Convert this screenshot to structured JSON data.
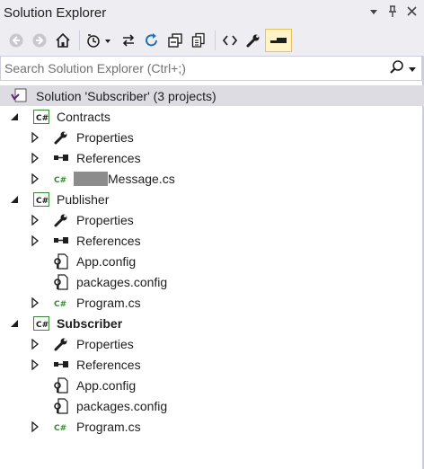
{
  "window": {
    "title": "Solution Explorer"
  },
  "search": {
    "placeholder": "Search Solution Explorer (Ctrl+;)"
  },
  "tree": {
    "solution": {
      "label": "Solution 'Subscriber' (3 projects)"
    },
    "projects": [
      {
        "name": "Contracts",
        "children": [
          {
            "label": "Properties",
            "icon": "wrench-icon"
          },
          {
            "label": "References",
            "icon": "references-icon"
          },
          {
            "label": "Message.cs",
            "icon": "csharp-file-icon",
            "redacted_prefix": true
          }
        ]
      },
      {
        "name": "Publisher",
        "children": [
          {
            "label": "Properties",
            "icon": "wrench-icon"
          },
          {
            "label": "References",
            "icon": "references-icon"
          },
          {
            "label": "App.config",
            "icon": "config-file-icon"
          },
          {
            "label": "packages.config",
            "icon": "config-file-icon"
          },
          {
            "label": "Program.cs",
            "icon": "csharp-file-icon"
          }
        ]
      },
      {
        "name": "Subscriber",
        "startup": true,
        "children": [
          {
            "label": "Properties",
            "icon": "wrench-icon"
          },
          {
            "label": "References",
            "icon": "references-icon"
          },
          {
            "label": "App.config",
            "icon": "config-file-icon"
          },
          {
            "label": "packages.config",
            "icon": "config-file-icon"
          },
          {
            "label": "Program.cs",
            "icon": "csharp-file-icon"
          }
        ]
      }
    ]
  },
  "colors": {
    "accent": "#007acc",
    "csharp_green": "#388a34",
    "selected_row": "#dcdce2",
    "toolbar_bg": "#eeeef2",
    "active_button": "#fff4c7"
  }
}
